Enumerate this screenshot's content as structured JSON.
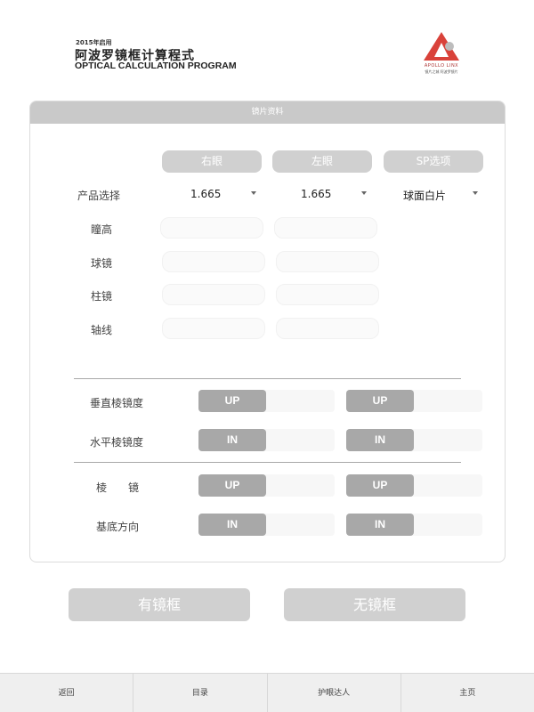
{
  "header": {
    "year": "2015年启用",
    "title": "阿波罗镜框计算程式",
    "subtitle": "OPTICAL CALCULATION PROGRAM",
    "logo_text": "APOLLO LINX",
    "logo_tag": "镜片之城 阿波罗镜片"
  },
  "card": {
    "title": "镜片资料",
    "columns": {
      "right": "右眼",
      "left": "左眼",
      "sp": "SP选项"
    },
    "product_label": "产品选择",
    "product_right": "1.665",
    "product_left": "1.665",
    "product_sp": "球面白片",
    "rows": [
      "瞳高",
      "球镜",
      "柱镜",
      "轴线"
    ],
    "prism_rows": [
      {
        "label": "垂直棱镜度",
        "right_btn": "UP",
        "left_btn": "UP"
      },
      {
        "label": "水平棱镜度",
        "right_btn": "IN",
        "left_btn": "IN"
      },
      {
        "label": "棱　　镜",
        "right_btn": "UP",
        "left_btn": "UP"
      },
      {
        "label": "基底方向",
        "right_btn": "IN",
        "left_btn": "IN"
      }
    ]
  },
  "actions": {
    "with_frame": "有镜框",
    "without_frame": "无镜框"
  },
  "bottom_nav": [
    "返回",
    "目录",
    "护眼达人",
    "主页"
  ],
  "colors": {
    "logo_red": "#d9423a",
    "button_gray": "#d0d0d0",
    "toggle_gray": "#a8a8a8"
  }
}
